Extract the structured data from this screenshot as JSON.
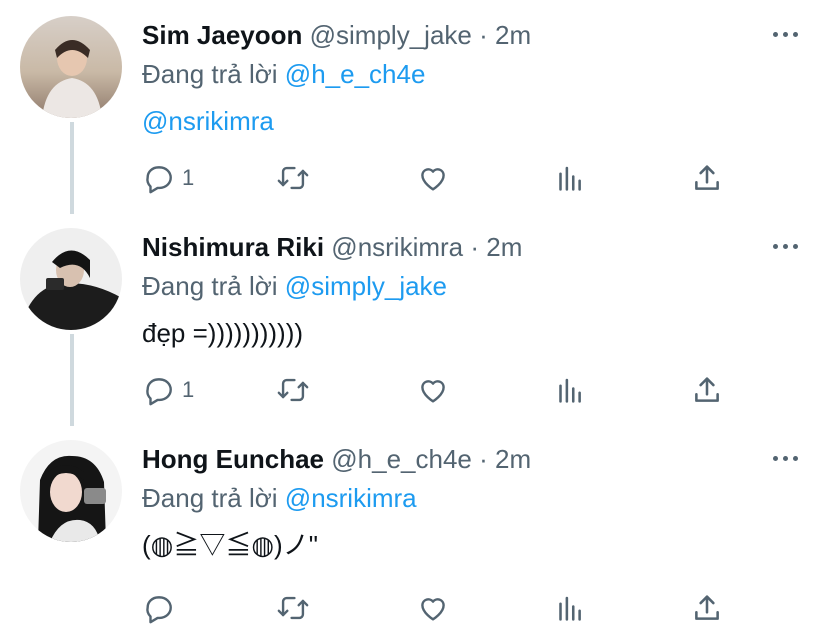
{
  "replying_prefix": "Đang trả lời",
  "tweets": [
    {
      "name": "Sim Jaeyoon",
      "handle": "@simply_jake",
      "dot": "·",
      "time": "2m",
      "reply_to": "@h_e_ch4e",
      "text": "@nsrikimra",
      "reply_count": "1"
    },
    {
      "name": "Nishimura Riki",
      "handle": "@nsrikimra",
      "dot": "·",
      "time": "2m",
      "reply_to": "@simply_jake",
      "text": "đẹp =)))))))))))",
      "reply_count": "1"
    },
    {
      "name": "Hong Eunchae",
      "handle": "@h_e_ch4e",
      "dot": "·",
      "time": "2m",
      "reply_to": "@nsrikimra",
      "text": "(◍≧▽≦◍)ノ\"",
      "reply_count": ""
    }
  ],
  "icons": {
    "reply": "reply-icon",
    "retweet": "retweet-icon",
    "like": "heart-icon",
    "views": "views-icon",
    "share": "share-icon",
    "more": "more-icon"
  },
  "colors": {
    "accent": "#1d9bf0",
    "secondary_text": "#536471",
    "thread_line": "#cfd9de"
  }
}
